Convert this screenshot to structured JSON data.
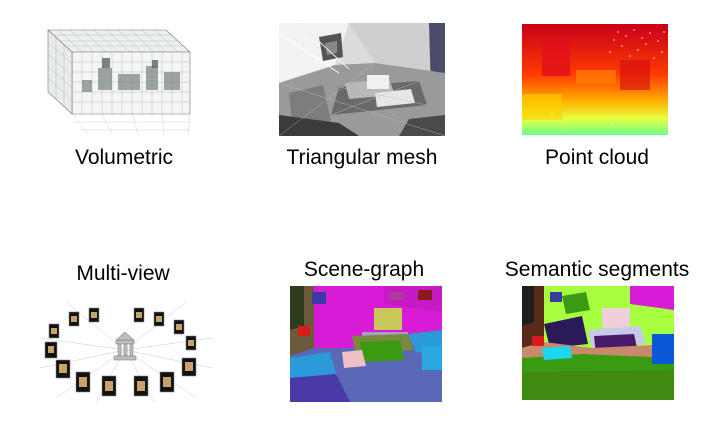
{
  "panels": [
    {
      "id": "volumetric",
      "label": "Volumetric"
    },
    {
      "id": "mesh",
      "label": "Triangular mesh"
    },
    {
      "id": "pointcloud",
      "label": "Point cloud"
    },
    {
      "id": "multiview",
      "label": "Multi-view"
    },
    {
      "id": "scenegraph",
      "label": "Scene-graph"
    },
    {
      "id": "semantic",
      "label": "Semantic segments"
    }
  ],
  "colors": {
    "background": "#ffffff",
    "text": "#000000",
    "pointcloud_top": "#c8001a",
    "pointcloud_mid": "#ff5a00",
    "pointcloud_low": "#e8ff40",
    "pointcloud_bottom": "#6cff88",
    "segment_magenta": "#d81bd6",
    "segment_blue": "#5b68b8",
    "segment_green": "#3a9b12",
    "segment_yellow": "#c8c85a",
    "segment_olive": "#7a8a3c"
  }
}
